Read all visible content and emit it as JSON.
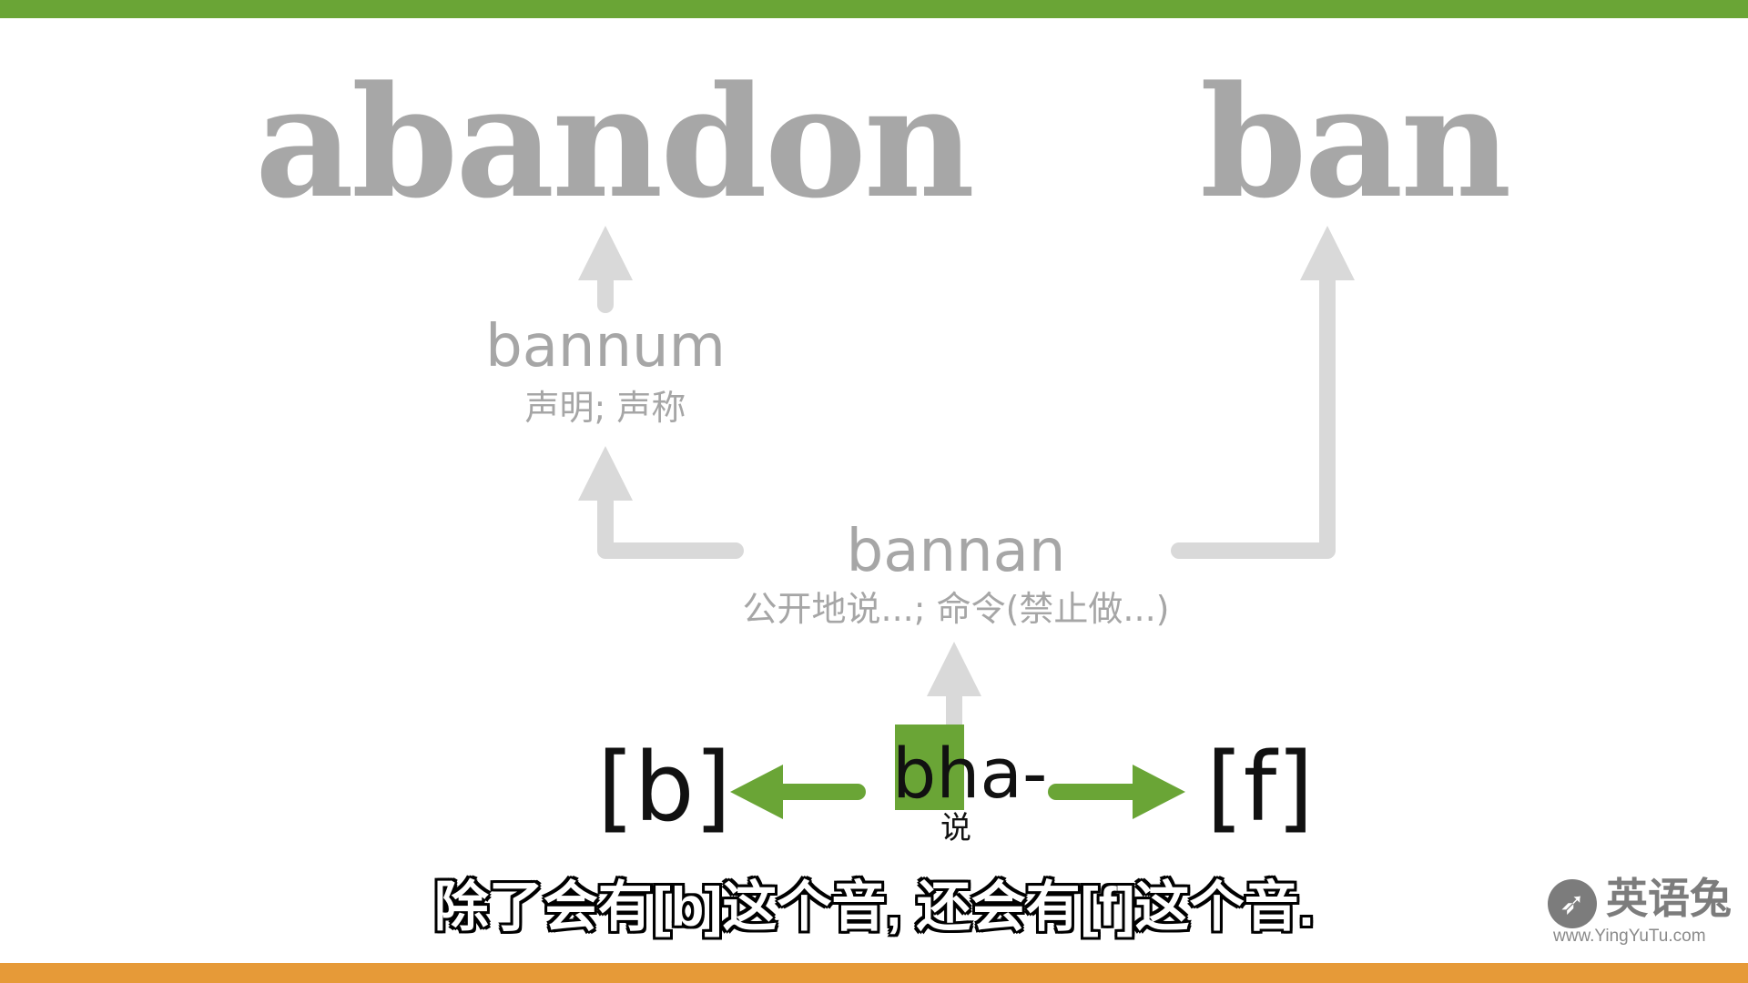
{
  "colors": {
    "top_bar": "#6aa536",
    "bottom_bar": "#e69a38",
    "faded_text": "#a6a6a6",
    "faded_word": "#a7a7a7",
    "faded_arrow": "#d9d9d9",
    "accent_green": "#6aa536",
    "dark_text": "#111111"
  },
  "words": {
    "abandon": "abandon",
    "ban": "ban"
  },
  "bannum": {
    "word": "bannum",
    "meaning": "声明; 声称"
  },
  "bannan": {
    "word": "bannan",
    "meaning": "公开地说...; 命令(禁止做...)"
  },
  "root": {
    "word": "bha-",
    "meaning": "说"
  },
  "sounds": {
    "left": "[b]",
    "right": "[f]"
  },
  "subtitle": "除了会有[b]这个音, 还会有[f]这个音.",
  "logo": {
    "icon": "rabbit-logo-icon",
    "name": "英语兔",
    "url": "www.YingYuTu.com"
  }
}
